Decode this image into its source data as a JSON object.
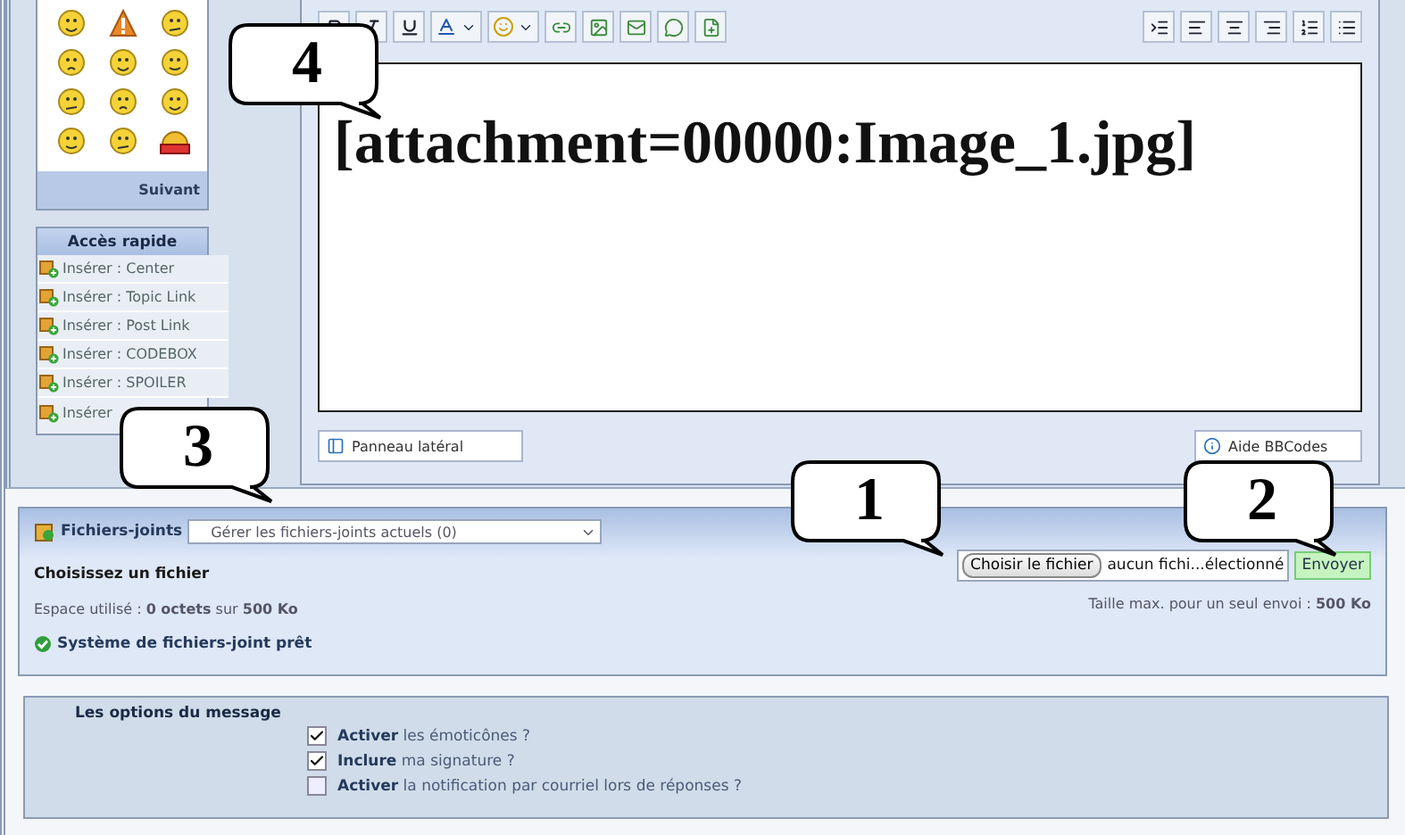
{
  "smiley_panel": {
    "next_label": "Suivant"
  },
  "quick_access": {
    "title": "Accès rapide",
    "items": [
      "Insérer : Center",
      "Insérer : Topic Link",
      "Insérer : Post Link",
      "Insérer : CODEBOX",
      "Insérer : SPOILER",
      "Insérer"
    ]
  },
  "editor": {
    "text": "[attachment=00000:Image_1.jpg]",
    "side_panel_button": "Panneau latéral",
    "help_button": "Aide BBCodes"
  },
  "attachments": {
    "label": "Fichiers-joints",
    "manage_select": "Gérer les fichiers-joints actuels (0)",
    "choose_heading": "Choisissez un fichier",
    "space_used": "Espace utilisé : **0 octets** sur **500 Ko**",
    "status": "Système de fichiers-joint prêt",
    "file_button": "Choisir le fichier",
    "file_status": "aucun fichi...électionné",
    "send_button": "Envoyer",
    "max_size": "Taille max. pour un seul envoi : **500 Ko**"
  },
  "options": {
    "title": "Les options du message",
    "items": [
      {
        "label": "**Activer** les émoticônes ?",
        "checked": true
      },
      {
        "label": "**Inclure** ma signature ?",
        "checked": true
      },
      {
        "label": "**Activer** la notification par courriel lors de réponses ?",
        "checked": false
      }
    ]
  },
  "callouts": [
    {
      "label": "4"
    },
    {
      "label": "3"
    },
    {
      "label": "1"
    },
    {
      "label": "2"
    }
  ]
}
